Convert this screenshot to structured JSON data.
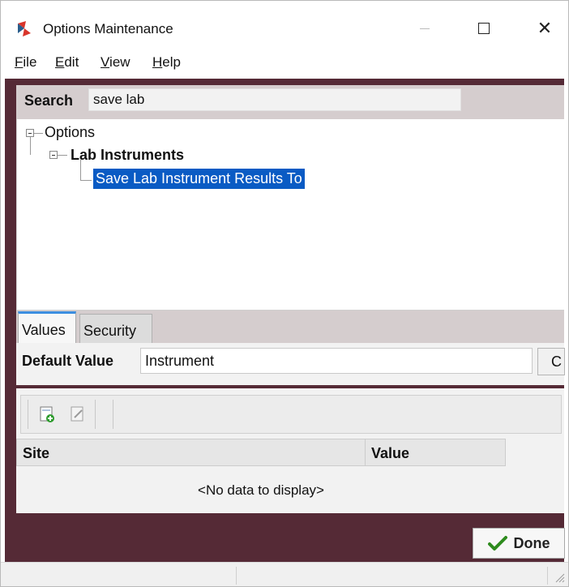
{
  "window": {
    "title": "Options Maintenance"
  },
  "menu": {
    "items": [
      {
        "first": "F",
        "rest": "ile"
      },
      {
        "first": "E",
        "rest": "dit"
      },
      {
        "first": "V",
        "rest": "iew"
      },
      {
        "first": "H",
        "rest": "elp"
      }
    ]
  },
  "search": {
    "label": "Search",
    "value": "save lab"
  },
  "tree": {
    "root": "Options",
    "category": "Lab Instruments",
    "selected_item": "Save Lab Instrument Results To"
  },
  "tabs": {
    "values": "Values",
    "security": "Security"
  },
  "default_value": {
    "label": "Default Value",
    "value": "Instrument",
    "button": "C"
  },
  "grid": {
    "columns": [
      "Site",
      "Value"
    ],
    "empty": "<No data to display>"
  },
  "done_button": {
    "label": "Done"
  },
  "colors": {
    "frame": "#552a36",
    "selection": "#0a5bc4",
    "tab_accent": "#3c8ee0",
    "check": "#2e8b1e"
  }
}
